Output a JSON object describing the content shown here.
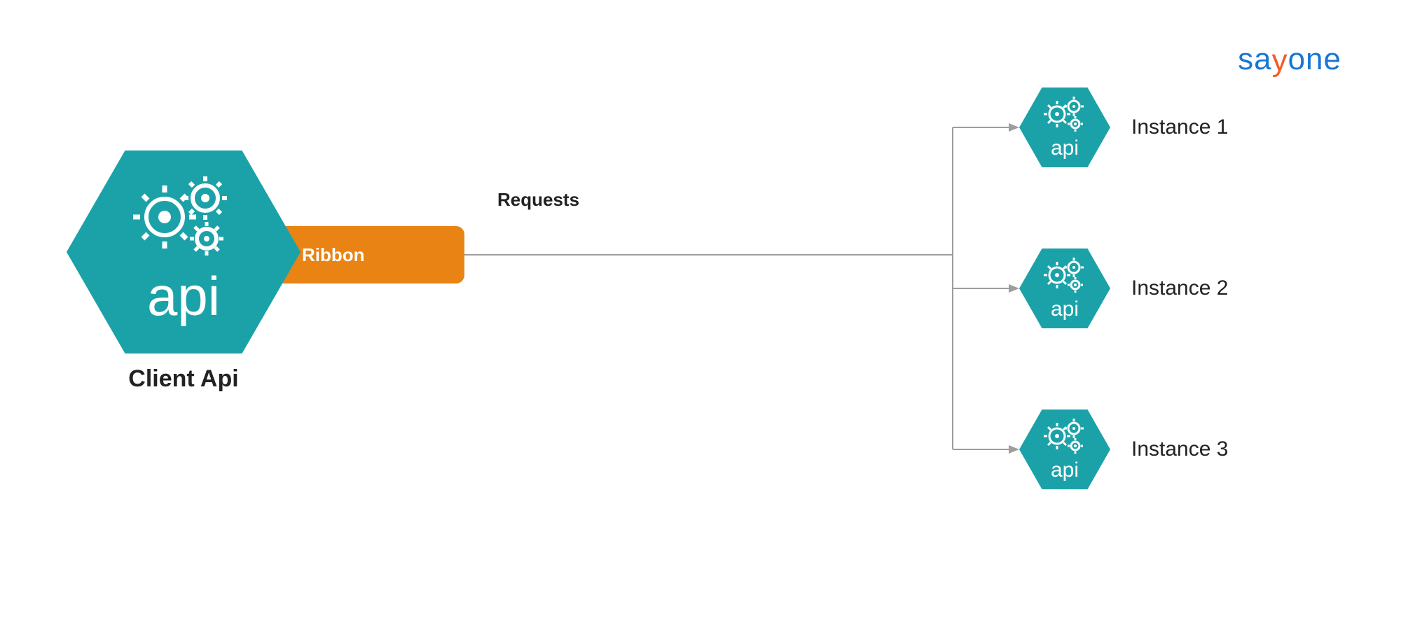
{
  "logo": {
    "part1": "sa",
    "accent": "y",
    "part2": "one"
  },
  "client": {
    "label": "Client Api",
    "hex_text": "api"
  },
  "ribbon": {
    "label": "Ribbon"
  },
  "flow": {
    "requests_label": "Requests"
  },
  "instances": [
    {
      "label": "Instance 1",
      "hex_text": "api"
    },
    {
      "label": "Instance 2",
      "hex_text": "api"
    },
    {
      "label": "Instance 3",
      "hex_text": "api"
    }
  ],
  "colors": {
    "teal": "#1ba2a8",
    "orange": "#e88314",
    "logo_blue": "#1976d2",
    "logo_orange": "#f25c2a",
    "connector": "#9d9d9d"
  }
}
